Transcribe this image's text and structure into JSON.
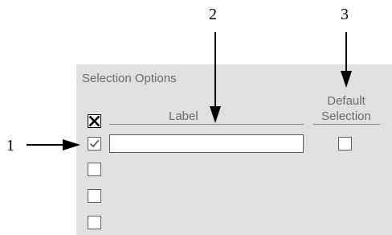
{
  "callouts": [
    "1",
    "2",
    "3"
  ],
  "panel": {
    "title": "Selection Options",
    "columns": {
      "label": "Label",
      "default_line1": "Default",
      "default_line2": "Selection"
    }
  },
  "header_toggle": {
    "state": "x"
  },
  "rows": [
    {
      "checked": true,
      "label_value": "",
      "default_checked": false
    },
    {
      "checked": false
    },
    {
      "checked": false
    },
    {
      "checked": false
    }
  ],
  "icons": {
    "header_toggle": "x-mark-icon",
    "check": "check-mark-icon",
    "callout_arrow": "arrow-icon"
  }
}
